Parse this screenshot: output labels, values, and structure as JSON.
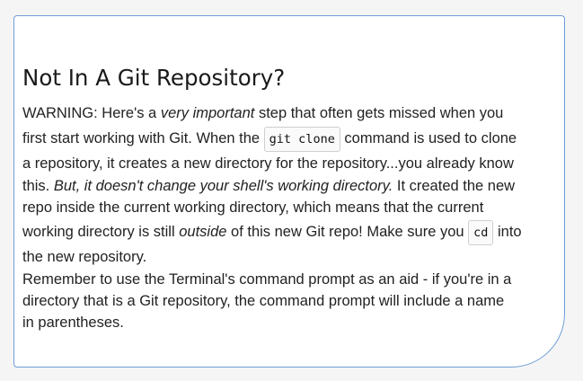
{
  "heading": "Not In A Git Repository?",
  "warning": {
    "l1_a": "WARNING: Here's a ",
    "l1_em": "very important",
    "l1_b": " step that often gets missed when you",
    "l2_a": "first start working with Git. When the ",
    "l2_code": "git clone",
    "l2_b": " command is used to clone",
    "l3": "a repository, it creates a new directory for the repository...you already know",
    "l4_a": "this. ",
    "l4_em": "But, it doesn't change your shell's working directory.",
    "l4_b": " It created the new",
    "l5": "repo inside the current working directory, which means that the current",
    "l6_a": "working directory is still ",
    "l6_em": "outside",
    "l6_b": " of this new Git repo! Make sure you ",
    "l6_code": "cd",
    "l6_c": " into",
    "l7": "the new repository."
  },
  "reminder": {
    "l1": "Remember to use the Terminal's command prompt as an aid - if you're in a",
    "l2": "directory that is a Git repository, the command prompt will include a name",
    "l3": "in parentheses."
  },
  "colors": {
    "card_border": "#6f9ed8",
    "page_background": "#f5f5f5"
  }
}
